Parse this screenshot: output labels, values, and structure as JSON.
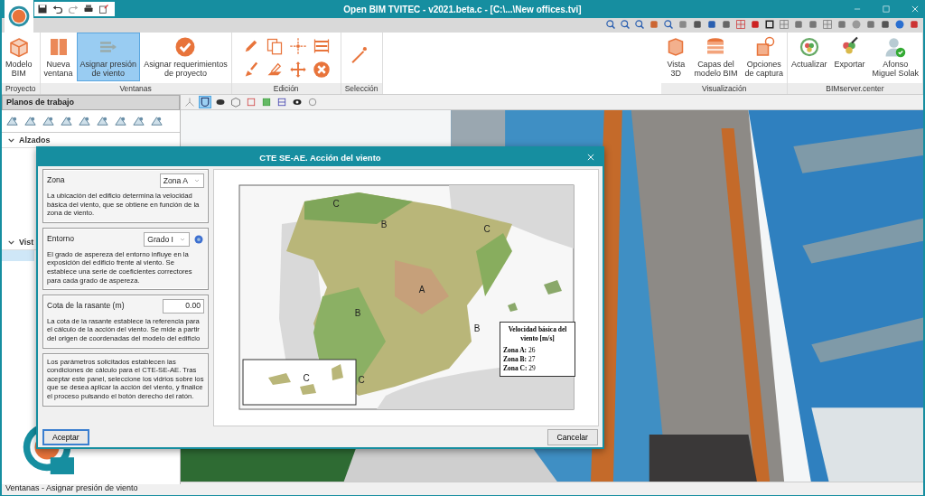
{
  "window": {
    "title": "Open BIM TVITEC - v2021.beta.c - [C:\\...\\New offices.tvi]"
  },
  "ribbon": {
    "left_groups": [
      {
        "label": "Proyecto",
        "kind": "buttons",
        "buttons": [
          {
            "lines": [
              "Modelo",
              "BIM"
            ],
            "selected": false
          }
        ]
      },
      {
        "label": "Ventanas",
        "kind": "buttons",
        "buttons": [
          {
            "lines": [
              "Nueva",
              "ventana"
            ],
            "selected": false
          },
          {
            "lines": [
              "Asignar presión",
              "de viento"
            ],
            "selected": true
          },
          {
            "lines": [
              "Asignar requerimientos",
              "de proyecto"
            ],
            "selected": false
          }
        ]
      },
      {
        "label": "Edición",
        "kind": "edit_tools"
      },
      {
        "label": "Selección",
        "kind": "select_tools"
      }
    ],
    "right_groups": [
      {
        "label": "Visualización",
        "kind": "buttons",
        "buttons": [
          {
            "lines": [
              "Vista",
              "3D"
            ],
            "selected": false
          },
          {
            "lines": [
              "Capas del",
              "modelo BIM"
            ],
            "selected": false
          },
          {
            "lines": [
              "Opciones",
              "de captura"
            ],
            "selected": false
          }
        ]
      },
      {
        "label": "BIMserver.center",
        "kind": "buttons",
        "buttons": [
          {
            "lines": [
              "Actualizar"
            ],
            "selected": false
          },
          {
            "lines": [
              "Exportar"
            ],
            "selected": false
          },
          {
            "lines": [
              "Afonso",
              "Miguel Solak"
            ],
            "selected": false
          }
        ]
      }
    ]
  },
  "panel": {
    "title": "Planos de trabajo",
    "tree": [
      {
        "label": "Alzados",
        "expanded": true
      },
      {
        "label": "Vist",
        "expanded": true
      }
    ]
  },
  "dialog": {
    "title": "CTE SE-AE. Acción del viento",
    "sections": [
      {
        "kind": "select",
        "label": "Zona",
        "value": "Zona A",
        "text": "La ubicación del edificio determina la velocidad básica del viento, que se obtiene en función de la zona de viento."
      },
      {
        "kind": "select",
        "label": "Entorno",
        "value": "Grado I",
        "help": true,
        "text": "El grado de aspereza del entorno influye en la exposición del edificio frente al viento. Se establece una serie de coeficientes correctores para cada grado de aspereza."
      },
      {
        "kind": "number",
        "label": "Cota de la rasante (m)",
        "value": "0.00",
        "text": "La cota de la rasante establece la referencia para el cálculo de la acción del viento. Se mide a partir del origen de coordenadas del modelo del edificio"
      },
      {
        "kind": "note",
        "text": "Los parámetros solicitados establecen las condiciones de cálculo para el CTE-SE-AE. Tras aceptar este panel, seleccione los vidrios sobre los que se desea aplicar la acción del viento, y finalice el proceso pulsando el botón derecho del ratón."
      }
    ],
    "map": {
      "zones": [
        {
          "label": "C"
        },
        {
          "label": "B"
        },
        {
          "label": "C"
        },
        {
          "label": "A"
        },
        {
          "label": "B"
        },
        {
          "label": "B"
        },
        {
          "label": "C"
        },
        {
          "label": "C"
        }
      ],
      "legend": {
        "title": "Velocidad básica del viento [m/s]",
        "rows": [
          {
            "zone": "Zona A:",
            "value": "26"
          },
          {
            "zone": "Zona B:",
            "value": "27"
          },
          {
            "zone": "Zona C:",
            "value": "29"
          }
        ]
      }
    },
    "buttons": [
      {
        "label": "Aceptar",
        "default": true
      },
      {
        "label": "Cancelar",
        "default": false
      }
    ]
  },
  "status_bar": {
    "text": "Ventanas - Asignar presión de viento"
  }
}
